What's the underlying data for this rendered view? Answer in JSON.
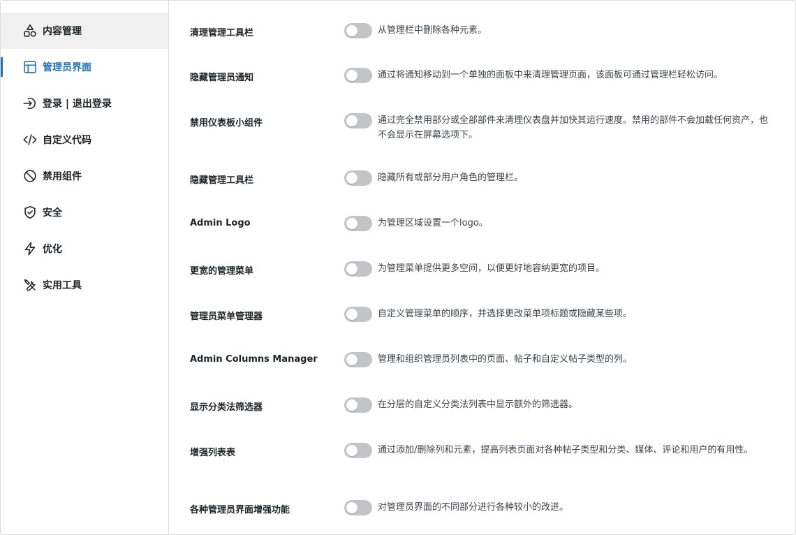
{
  "sidebar": {
    "items": [
      {
        "label": "内容管理",
        "icon": "shapes-icon"
      },
      {
        "label": "管理员界面",
        "icon": "layout-icon"
      },
      {
        "label": "登录 | 退出登录",
        "icon": "login-icon"
      },
      {
        "label": "自定义代码",
        "icon": "code-icon"
      },
      {
        "label": "禁用组件",
        "icon": "ban-icon"
      },
      {
        "label": "安全",
        "icon": "shield-icon"
      },
      {
        "label": "优化",
        "icon": "lightning-icon"
      },
      {
        "label": "实用工具",
        "icon": "tools-icon"
      }
    ],
    "active_index": 1
  },
  "settings": [
    {
      "label": "清理管理工具栏",
      "description": "从管理栏中删除各种元素。",
      "enabled": false
    },
    {
      "label": "隐藏管理员通知",
      "description": "通过将通知移动到一个单独的面板中来清理管理页面，该面板可通过管理栏轻松访问。",
      "enabled": false
    },
    {
      "label": "禁用仪表板小组件",
      "description": "通过完全禁用部分或全部部件来清理仪表盘并加快其运行速度。禁用的部件不会加载任何资产，也不会显示在屏幕选项下。",
      "enabled": false
    },
    {
      "label": "隐藏管理工具栏",
      "description": "隐藏所有或部分用户角色的管理栏。",
      "enabled": false
    },
    {
      "label": "Admin Logo",
      "description": "为管理区域设置一个logo。",
      "enabled": false
    },
    {
      "label": "更宽的管理菜单",
      "description": "为管理菜单提供更多空间，以便更好地容纳更宽的项目。",
      "enabled": false
    },
    {
      "label": "管理员菜单管理器",
      "description": "自定义管理菜单的顺序，并选择更改菜单项标题或隐藏某些项。",
      "enabled": false
    },
    {
      "label": "Admin Columns Manager",
      "description": "管理和组织管理员列表中的页面、帖子和自定义帖子类型的列。",
      "enabled": false
    },
    {
      "label": "显示分类法筛选器",
      "description": "在分层的自定义分类法列表中显示额外的筛选器。",
      "enabled": false
    },
    {
      "label": "增强列表表",
      "description": "通过添加/删除列和元素，提高列表页面对各种帖子类型和分类、媒体、评论和用户的有用性。",
      "enabled": false
    },
    {
      "label": "各种管理员界面增强功能",
      "description": "对管理员界面的不同部分进行各种较小的改进。",
      "enabled": false
    }
  ],
  "colors": {
    "accent": "#2271b1",
    "toggle_off": "#c3c4c7",
    "text": "#1d2327"
  }
}
